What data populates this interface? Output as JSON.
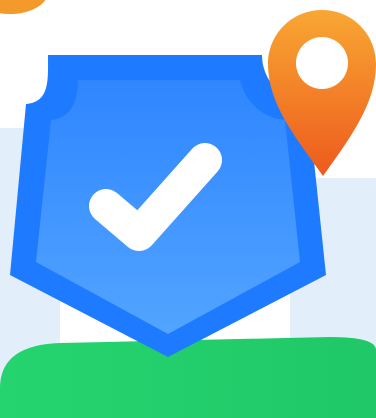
{
  "illustration": {
    "subject": "security-shield-with-location-pin",
    "icons": [
      "shield-icon",
      "checkmark-icon",
      "location-pin-icon"
    ],
    "colors": {
      "background": "#ffffff",
      "backdrop_light_blue": "#E3EEFB",
      "shield_outer": "#1E7BFF",
      "shield_inner_top": "#2F86FF",
      "shield_inner_bottom": "#52A4FF",
      "check": "#FFFFFF",
      "pin_top": "#F8A733",
      "pin_bottom": "#EE5A1D",
      "pin_hole": "#FFFFFF",
      "hill_green": "#25D46F",
      "blob_orange": "#F49A2A"
    }
  }
}
